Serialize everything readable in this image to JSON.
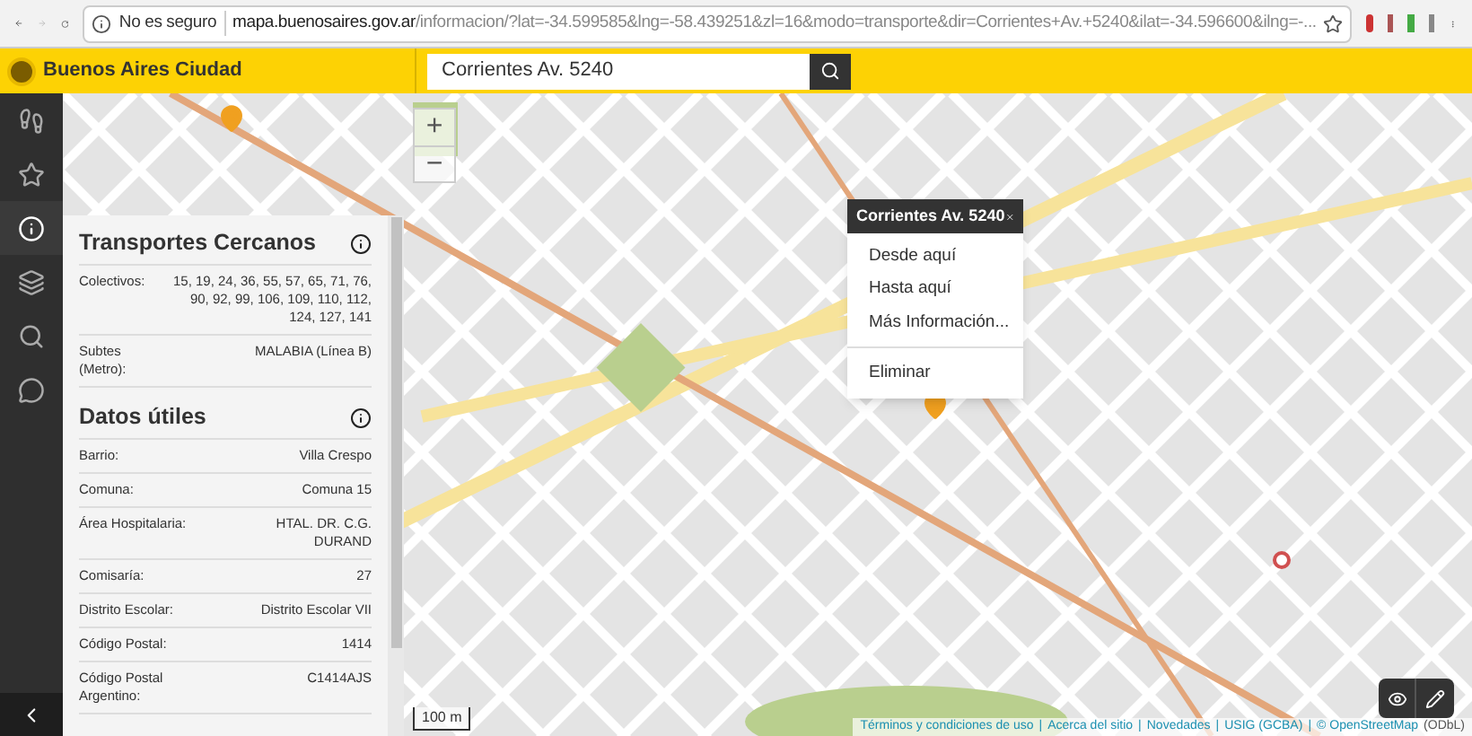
{
  "browser": {
    "security": "No es seguro",
    "url_host": "mapa.buenosaires.gov.ar",
    "url_path": "/informacion/?lat=-34.599585&lng=-58.439251&zl=16&modo=transporte&dir=Corrientes+Av.+5240&ilat=-34.596600&ilng=-..."
  },
  "header": {
    "brand": "Buenos Aires Ciudad",
    "search_value": "Corrientes Av. 5240"
  },
  "sidebar": {
    "items": [
      {
        "kind": "walk",
        "selected": false
      },
      {
        "kind": "star",
        "selected": false
      },
      {
        "kind": "info",
        "selected": true
      },
      {
        "kind": "layers",
        "selected": false
      },
      {
        "kind": "search",
        "selected": false
      },
      {
        "kind": "chat",
        "selected": false
      }
    ]
  },
  "panel": {
    "sections": [
      {
        "title": "Transportes Cercanos",
        "rows": [
          {
            "label": "Colectivos:",
            "value": "15, 19, 24, 36, 55, 57, 65, 71, 76, 90, 92, 99, 106, 109, 110, 112, 124, 127, 141"
          },
          {
            "label": "Subtes (Metro):",
            "value": "MALABIA (Línea B)"
          }
        ]
      },
      {
        "title": "Datos útiles",
        "rows": [
          {
            "label": "Barrio:",
            "value": "Villa Crespo"
          },
          {
            "label": "Comuna:",
            "value": "Comuna 15"
          },
          {
            "label": "Área Hospitalaria:",
            "value": "HTAL. DR. C.G. DURAND"
          },
          {
            "label": "Comisaría:",
            "value": "27"
          },
          {
            "label": "Distrito Escolar:",
            "value": "Distrito Escolar VII"
          },
          {
            "label": "Código Postal:",
            "value": "1414"
          },
          {
            "label": "Código Postal Argentino:",
            "value": "C1414AJS"
          }
        ]
      }
    ]
  },
  "map": {
    "zoom_in": "+",
    "zoom_out": "−",
    "scale": "100 m"
  },
  "popup": {
    "title": "Corrientes Av. 5240",
    "items": [
      "Desde aquí",
      "Hasta aquí",
      "Más Información..."
    ],
    "remove": "Eliminar"
  },
  "footer": {
    "links": [
      "Términos y condiciones de uso",
      "Acerca del sitio",
      "Novedades",
      "USIG (GCBA)",
      "© OpenStreetMap"
    ],
    "separator": "|",
    "trailing": "(ODbL)"
  }
}
